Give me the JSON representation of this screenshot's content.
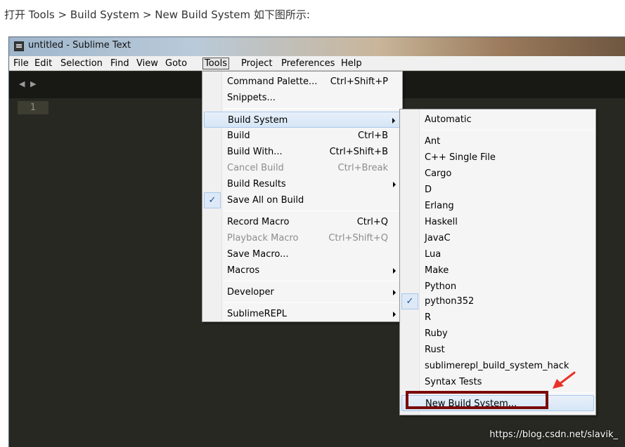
{
  "caption": "打开 Tools > Build System > New Build System  如下图所示:",
  "window": {
    "title": "untitled - Sublime Text"
  },
  "menubar": [
    "File",
    "Edit",
    "Selection",
    "Find",
    "View",
    "Goto",
    "Tools",
    "Project",
    "Preferences",
    "Help"
  ],
  "tab_arrows": "◀ ▶",
  "editor": {
    "line_number": "1"
  },
  "tools_menu": [
    {
      "label": "Command Palette...",
      "shortcut": "Ctrl+Shift+P"
    },
    {
      "label": "Snippets...",
      "shortcut": ""
    },
    {
      "label": "Build System",
      "shortcut": "",
      "submenu": true,
      "highlighted": true
    },
    {
      "label": "Build",
      "shortcut": "Ctrl+B"
    },
    {
      "label": "Build With...",
      "shortcut": "Ctrl+Shift+B"
    },
    {
      "label": "Cancel Build",
      "shortcut": "Ctrl+Break",
      "disabled": true
    },
    {
      "label": "Build Results",
      "shortcut": "",
      "submenu": true
    },
    {
      "label": "Save All on Build",
      "shortcut": "",
      "checked": true
    },
    {
      "label": "Record Macro",
      "shortcut": "Ctrl+Q"
    },
    {
      "label": "Playback Macro",
      "shortcut": "Ctrl+Shift+Q",
      "disabled": true
    },
    {
      "label": "Save Macro...",
      "shortcut": ""
    },
    {
      "label": "Macros",
      "shortcut": "",
      "submenu": true
    },
    {
      "label": "Developer",
      "shortcut": "",
      "submenu": true
    },
    {
      "label": "SublimeREPL",
      "shortcut": "",
      "submenu": true
    }
  ],
  "build_system_menu": [
    {
      "label": "Automatic"
    },
    {
      "label": "Ant"
    },
    {
      "label": "C++ Single File"
    },
    {
      "label": "Cargo"
    },
    {
      "label": "D"
    },
    {
      "label": "Erlang"
    },
    {
      "label": "Haskell"
    },
    {
      "label": "JavaC"
    },
    {
      "label": "Lua"
    },
    {
      "label": "Make"
    },
    {
      "label": "Python"
    },
    {
      "label": "python352",
      "checked": true
    },
    {
      "label": "R"
    },
    {
      "label": "Ruby"
    },
    {
      "label": "Rust"
    },
    {
      "label": "sublimerepl_build_system_hack"
    },
    {
      "label": "Syntax Tests"
    },
    {
      "label": "New Build System...",
      "highlighted": true
    }
  ],
  "check_mark": "✓",
  "watermark": "https://blog.csdn.net/slavik_",
  "colors": {
    "editor_bg": "#272822",
    "annotation_red": "#7a0a0a",
    "arrow_red": "#e8322a"
  }
}
